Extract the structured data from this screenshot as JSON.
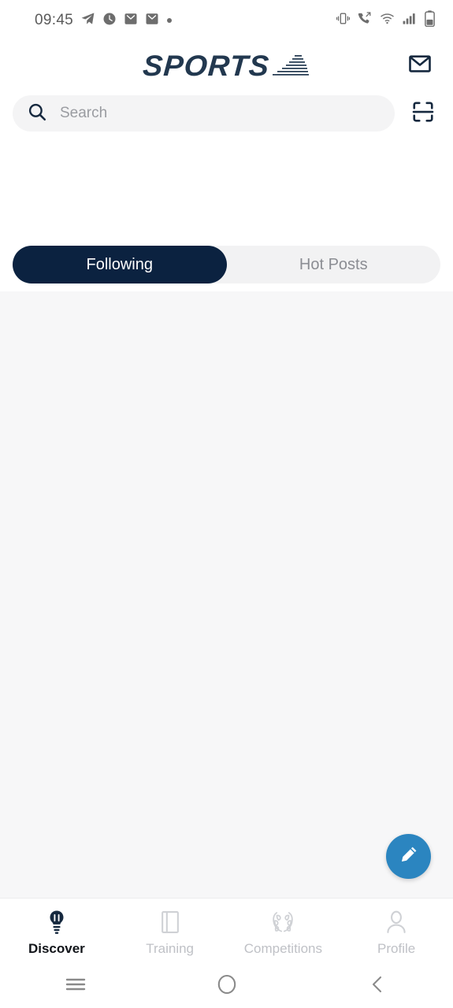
{
  "status_bar": {
    "time": "09:45",
    "left_icons": [
      "telegram-icon",
      "clock-icon",
      "mail-notification-icon",
      "mail-notification-icon",
      "dot-icon"
    ],
    "right_icons": [
      "vibrate-icon",
      "missed-call-icon",
      "wifi-icon",
      "signal-icon",
      "battery-icon"
    ]
  },
  "header": {
    "logo_text": "SPORTS",
    "logo_graphic": "speed-lines-icon",
    "mail_icon": "envelope-icon"
  },
  "search": {
    "placeholder": "Search",
    "value": "",
    "search_icon": "search-icon",
    "scan_icon": "scan-qr-icon"
  },
  "tabs": [
    {
      "label": "Following",
      "active": true
    },
    {
      "label": "Hot Posts",
      "active": false
    }
  ],
  "feed": {
    "items": [],
    "fab_icon": "pencil-icon"
  },
  "bottom_nav": [
    {
      "label": "Discover",
      "icon": "lightbulb-icon",
      "active": true
    },
    {
      "label": "Training",
      "icon": "book-icon",
      "active": false
    },
    {
      "label": "Competitions",
      "icon": "laurel-wreath-icon",
      "active": false
    },
    {
      "label": "Profile",
      "icon": "person-icon",
      "active": false
    }
  ],
  "android_nav": {
    "recents": "menu-icon",
    "home": "circle-icon",
    "back": "chevron-left-icon"
  },
  "colors": {
    "brand_navy": "#0b2240",
    "logo_navy": "#22384f",
    "fab_blue": "#2b85c0",
    "feed_bg": "#f7f7f8",
    "search_bg": "#f4f4f5",
    "inactive_gray": "#bfc1c6"
  }
}
